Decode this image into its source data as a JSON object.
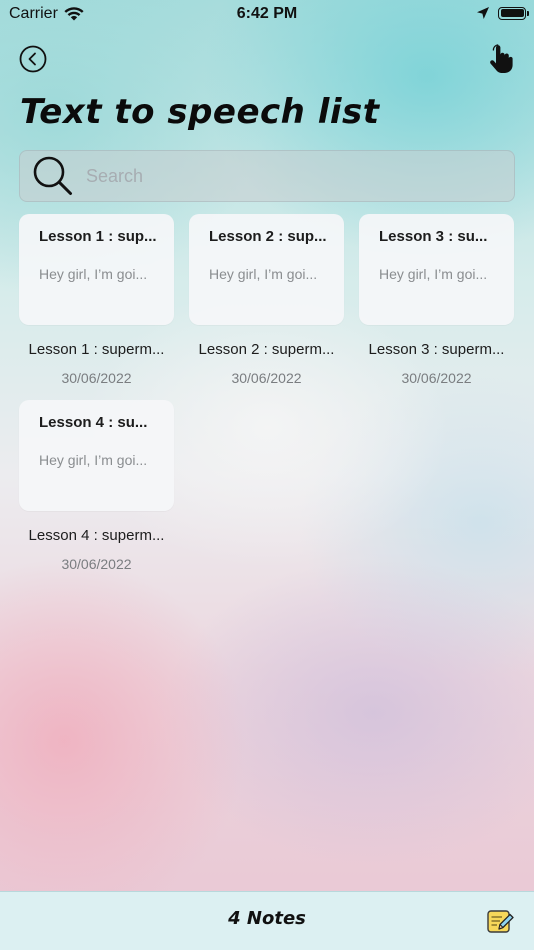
{
  "status_bar": {
    "carrier": "Carrier",
    "time": "6:42 PM"
  },
  "header": {
    "title": "Text to speech list"
  },
  "search": {
    "placeholder": "Search",
    "value": ""
  },
  "notes": [
    {
      "card_title": "Lesson 1 : sup...",
      "preview": "Hey girl, I’m goi...",
      "name": "Lesson 1 : superm...",
      "date": "30/06/2022"
    },
    {
      "card_title": "Lesson 2 : sup...",
      "preview": "Hey girl, I’m goi...",
      "name": "Lesson 2 : superm...",
      "date": "30/06/2022"
    },
    {
      "card_title": "Lesson 3 : su...",
      "preview": "Hey girl, I’m goi...",
      "name": "Lesson 3 : superm...",
      "date": "30/06/2022"
    },
    {
      "card_title": "Lesson 4 : su...",
      "preview": "Hey girl, I’m goi...",
      "name": "Lesson 4 : superm...",
      "date": "30/06/2022"
    }
  ],
  "footer": {
    "count_label": "4 Notes"
  },
  "icons": {
    "back": "chevron-left-circle-icon",
    "tap": "hand-pointer-icon",
    "search": "magnifier-icon",
    "compose": "note-pencil-icon"
  },
  "colors": {
    "bottom_bar": "#dcf0f2",
    "card": "#f5f6f8",
    "compose_note": "#f6d75a"
  }
}
